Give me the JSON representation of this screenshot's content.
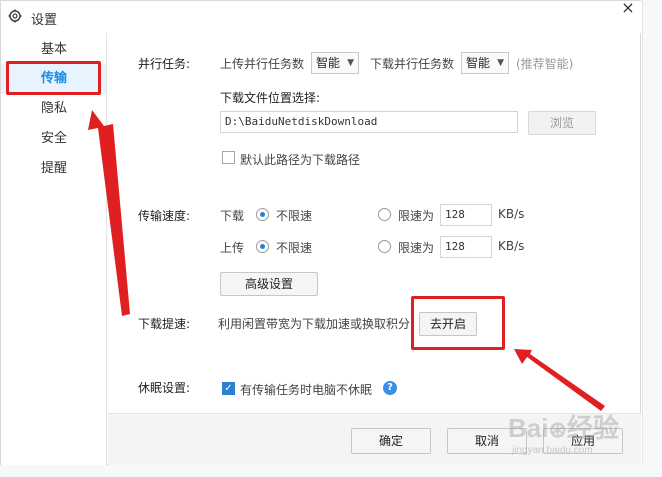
{
  "window": {
    "title": "设置",
    "close_glyph": "×"
  },
  "sidebar": {
    "items": [
      {
        "label": "基本"
      },
      {
        "label": "传输",
        "active": true
      },
      {
        "label": "隐私"
      },
      {
        "label": "安全"
      },
      {
        "label": "提醒"
      }
    ]
  },
  "parallel": {
    "label": "并行任务:",
    "upload_label": "上传并行任务数",
    "upload_value": "智能",
    "download_label": "下载并行任务数",
    "download_value": "智能",
    "hint": "(推荐智能)"
  },
  "download_location": {
    "label": "下载文件位置选择:",
    "path": "D:\\BaiduNetdiskDownload",
    "browse_label": "浏览",
    "default_checkbox_label": "默认此路径为下载路径",
    "default_checked": false
  },
  "speed": {
    "label": "传输速度:",
    "download_label": "下载",
    "upload_label": "上传",
    "unlimited_label": "不限速",
    "limit_label": "限速为",
    "download_limit": "128",
    "upload_limit": "128",
    "unit": "KB/s",
    "download_mode": "unlimited",
    "upload_mode": "unlimited",
    "advanced_label": "高级设置"
  },
  "boost": {
    "label": "下载提速:",
    "description": "利用闲置带宽为下载加速或换取积分",
    "button_label": "去开启"
  },
  "sleep": {
    "label": "休眠设置:",
    "checkbox_label": "有传输任务时电脑不休眠",
    "checked": true,
    "help_glyph": "?"
  },
  "footer": {
    "ok_label": "确定",
    "cancel_label": "取消",
    "apply_label": "应用"
  },
  "colors": {
    "accent": "#1a8fe8",
    "highlight": "#e02020"
  }
}
